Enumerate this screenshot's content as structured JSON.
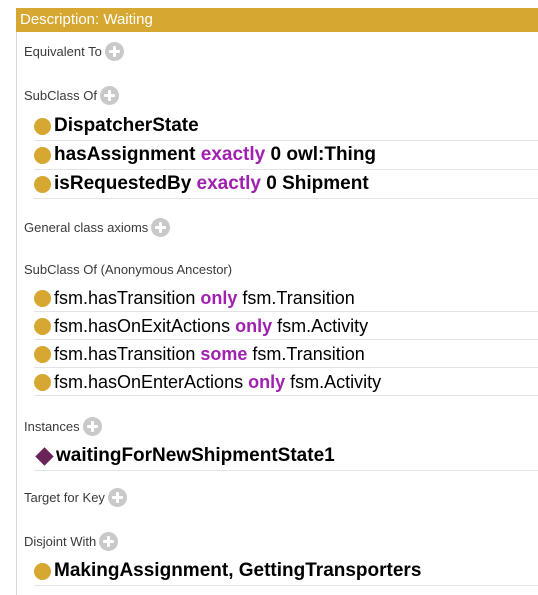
{
  "title": "Description: Waiting",
  "sections": {
    "equivalent_to": "Equivalent To",
    "subclass_of": "SubClass Of",
    "general_axioms": "General class axioms",
    "anon_ancestor": "SubClass Of (Anonymous Ancestor)",
    "instances": "Instances",
    "target_for_key": "Target for Key",
    "disjoint_with": "Disjoint With"
  },
  "subclass_of": {
    "row1": {
      "name": "DispatcherState"
    },
    "row2": {
      "prop": "hasAssignment ",
      "kw": "exactly",
      "rest": " 0 owl:Thing"
    },
    "row3": {
      "prop": "isRequestedBy ",
      "kw": "exactly",
      "rest": " 0 Shipment"
    }
  },
  "anon_ancestor": {
    "row1": {
      "prop": "fsm.hasTransition ",
      "kw": "only",
      "rest": " fsm.Transition"
    },
    "row2": {
      "prop": "fsm.hasOnExitActions ",
      "kw": "only",
      "rest": " fsm.Activity"
    },
    "row3": {
      "prop": "fsm.hasTransition ",
      "kw": "some",
      "rest": " fsm.Transition"
    },
    "row4": {
      "prop": "fsm.hasOnEnterActions ",
      "kw": "only",
      "rest": " fsm.Activity"
    }
  },
  "instances": {
    "row1": {
      "name": "waitingForNewShipmentState1"
    }
  },
  "disjoint_with": {
    "row1": {
      "name": "MakingAssignment, GettingTransporters"
    }
  },
  "colors": {
    "header": "#d6a731",
    "class_dot": "#d6a731",
    "individual_diamond": "#6b2458",
    "keyword": "#a020b0",
    "add_button": "#c9c9c9"
  }
}
